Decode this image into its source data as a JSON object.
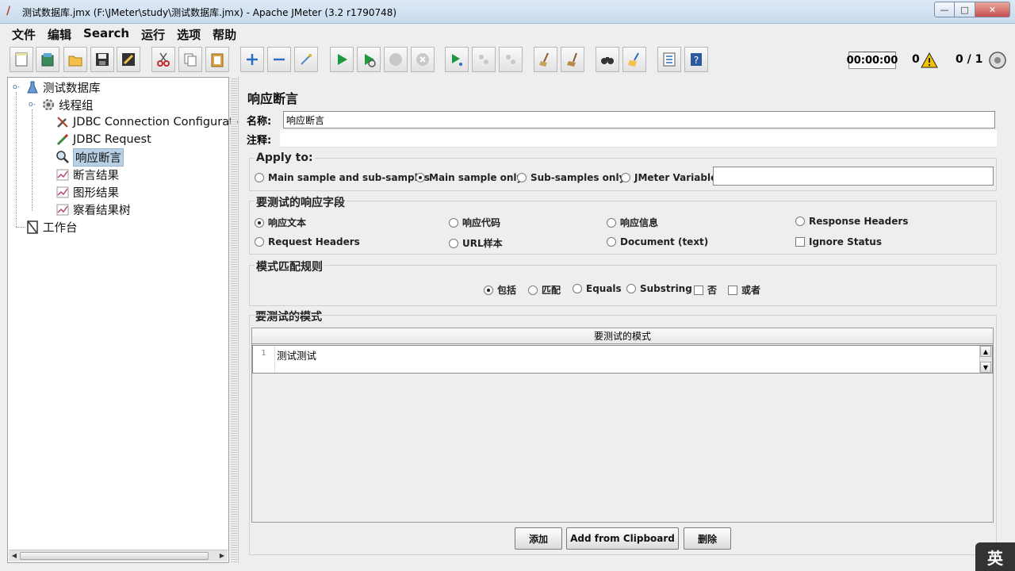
{
  "window": {
    "title": "测试数据库.jmx (F:\\JMeter\\study\\测试数据库.jmx) - Apache JMeter (3.2 r1790748)"
  },
  "menu": [
    "文件",
    "编辑",
    "Search",
    "运行",
    "选项",
    "帮助"
  ],
  "toolbar": {
    "timer": "00:00:00",
    "error_count": "0",
    "thread_count": "0 / 1"
  },
  "tree": {
    "nodes": [
      {
        "label": "测试数据库",
        "icon": "testplan-flask-icon"
      },
      {
        "label": "线程组",
        "icon": "gear-icon"
      },
      {
        "label": "JDBC Connection Configuratio",
        "icon": "wrench-icon"
      },
      {
        "label": "JDBC Request",
        "icon": "pipette-icon"
      },
      {
        "label": "响应断言",
        "icon": "magnifier-icon"
      },
      {
        "label": "断言结果",
        "icon": "graph-icon"
      },
      {
        "label": "图形结果",
        "icon": "graph-icon"
      },
      {
        "label": "察看结果树",
        "icon": "graph-icon"
      },
      {
        "label": "工作台",
        "icon": "workbench-icon"
      }
    ]
  },
  "editor": {
    "title": "响应断言",
    "name_label": "名称:",
    "name_value": "响应断言",
    "comment_label": "注释:",
    "comment_value": "",
    "apply_to": {
      "title": "Apply to:",
      "options": [
        "Main sample and sub-samples",
        "Main sample only",
        "Sub-samples only",
        "JMeter Variable"
      ],
      "selected": "Main sample only",
      "variable_value": ""
    },
    "response_field": {
      "title": "要测试的响应字段",
      "options": [
        "响应文本",
        "响应代码",
        "响应信息",
        "Response Headers",
        "Request Headers",
        "URL样本",
        "Document (text)"
      ],
      "selected": "响应文本",
      "ignore_status_label": "Ignore Status"
    },
    "pattern_rules": {
      "title": "模式匹配规则",
      "options": [
        "包括",
        "匹配",
        "Equals",
        "Substring"
      ],
      "selected": "包括",
      "not_label": "否",
      "or_label": "或者"
    },
    "patterns": {
      "title": "要测试的模式",
      "column_header": "要测试的模式",
      "rows": [
        {
          "line": "1",
          "text": "测试测试"
        }
      ]
    },
    "buttons": {
      "add": "添加",
      "add_clipboard": "Add from Clipboard",
      "delete": "删除"
    }
  },
  "ime": {
    "label": "英"
  }
}
